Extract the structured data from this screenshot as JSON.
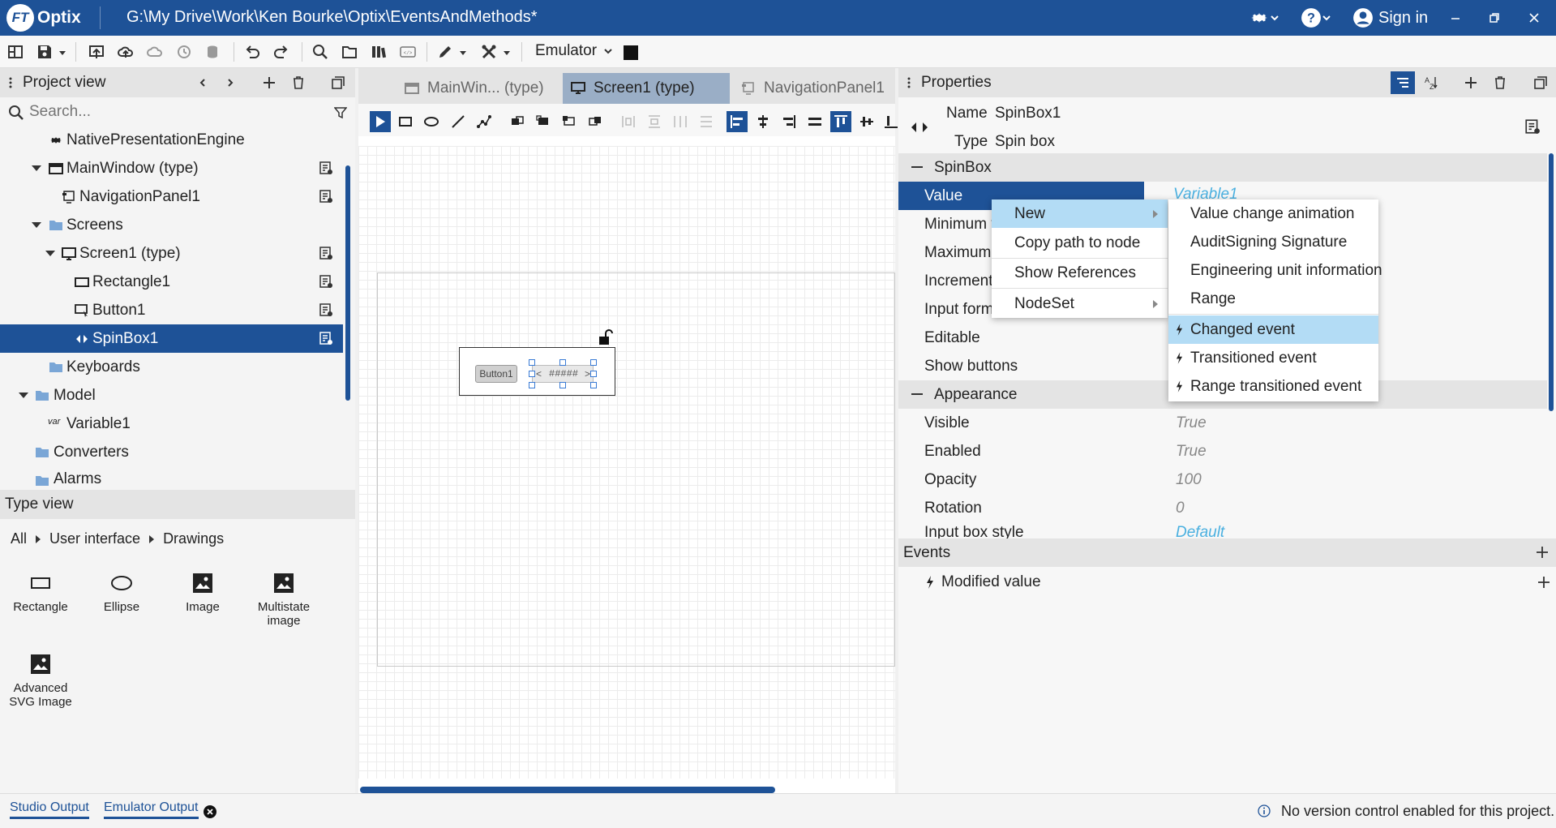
{
  "app": {
    "logo_text": "FT",
    "name": "Optix",
    "path": "G:\\My Drive\\Work\\Ken Bourke\\Optix\\EventsAndMethods*",
    "sign_in": "Sign in"
  },
  "colors": {
    "brand": "#1e5297",
    "selection": "#1e5297",
    "menu_highlight": "#b3dcf5",
    "link": "#4ab0e0"
  },
  "toolbar": {
    "emulator_label": "Emulator"
  },
  "project_view": {
    "title": "Project view",
    "search_placeholder": "Search...",
    "tree": [
      {
        "label": "NativePresentationEngine",
        "icon": "gear-icon"
      },
      {
        "label": "MainWindow (type)",
        "icon": "window-icon"
      },
      {
        "label": "NavigationPanel1",
        "icon": "navpanel-icon"
      },
      {
        "label": "Screens",
        "icon": "folder-icon"
      },
      {
        "label": "Screen1 (type)",
        "icon": "monitor-icon"
      },
      {
        "label": "Rectangle1",
        "icon": "rectangle-icon"
      },
      {
        "label": "Button1",
        "icon": "button-icon"
      },
      {
        "label": "SpinBox1",
        "icon": "spinbox-icon"
      },
      {
        "label": "Keyboards",
        "icon": "folder-icon"
      },
      {
        "label": "Model",
        "icon": "folder-icon"
      },
      {
        "label": "Variable1",
        "icon": "var-icon",
        "icon_text": "var"
      },
      {
        "label": "Converters",
        "icon": "folder-icon"
      },
      {
        "label": "Alarms",
        "icon": "folder-icon"
      }
    ]
  },
  "type_view": {
    "title": "Type view",
    "breadcrumb": [
      "All",
      "User interface",
      "Drawings"
    ],
    "items": [
      {
        "label": "Rectangle"
      },
      {
        "label": "Ellipse"
      },
      {
        "label": "Image"
      },
      {
        "label": "Multistate image"
      },
      {
        "label": "Advanced SVG Image"
      }
    ]
  },
  "editor": {
    "tabs": [
      {
        "label": "MainWin... (type)"
      },
      {
        "label": "Screen1 (type)"
      },
      {
        "label": "NavigationPanel1"
      }
    ],
    "canvas": {
      "button_label": "Button1",
      "spinbox_text": "#####",
      "spin_left": "<",
      "spin_right": ">"
    }
  },
  "properties": {
    "title": "Properties",
    "name_label": "Name",
    "name_value": "SpinBox1",
    "type_label": "Type",
    "type_value": "Spin box",
    "sections": {
      "spinbox": "SpinBox",
      "appearance": "Appearance",
      "events": "Events"
    },
    "spinbox_rows": [
      {
        "name": "Value",
        "value": "Variable1"
      },
      {
        "name": "Minimum v",
        "value": ""
      },
      {
        "name": "Maximum",
        "value": ""
      },
      {
        "name": "Increment",
        "value": ""
      },
      {
        "name": "Input form",
        "value": ""
      },
      {
        "name": "Editable",
        "value": ""
      },
      {
        "name": "Show buttons",
        "value": ""
      }
    ],
    "appearance_rows": [
      {
        "name": "Visible",
        "value": "True"
      },
      {
        "name": "Enabled",
        "value": "True"
      },
      {
        "name": "Opacity",
        "value": "100"
      },
      {
        "name": "Rotation",
        "value": "0"
      },
      {
        "name": "Input box style",
        "value": "Default"
      }
    ],
    "event_rows": [
      {
        "name": "Modified value"
      }
    ]
  },
  "context_menu": {
    "items": [
      "New",
      "Copy path to node",
      "Show References",
      "NodeSet"
    ]
  },
  "submenu": {
    "items": [
      "Value change animation",
      "AuditSigning Signature",
      "Engineering unit information",
      "Range"
    ],
    "events": [
      "Changed event",
      "Transitioned event",
      "Range transitioned event"
    ]
  },
  "status": {
    "studio_output": "Studio Output",
    "emulator_output": "Emulator Output",
    "message": "No version control enabled for this project."
  }
}
